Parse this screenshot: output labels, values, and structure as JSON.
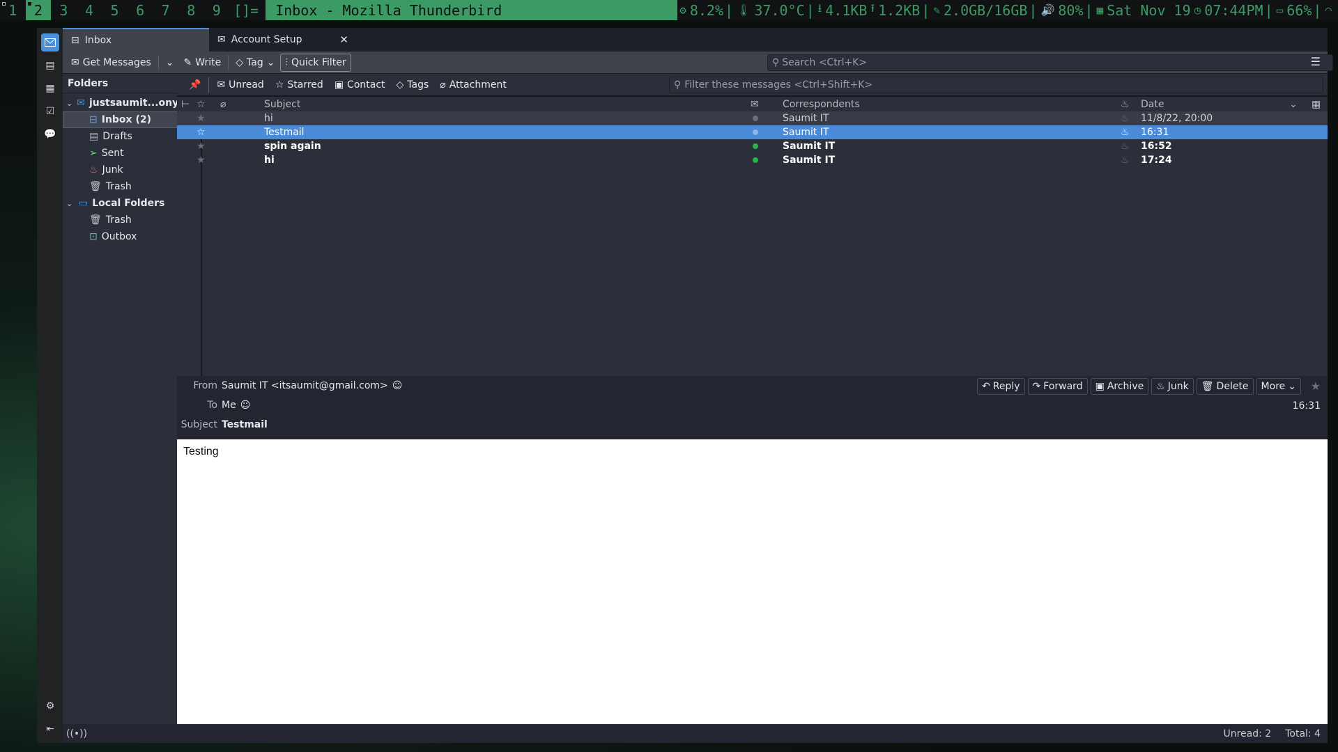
{
  "topbar": {
    "workspaces": [
      "1",
      "2",
      "3",
      "4",
      "5",
      "6",
      "7",
      "8",
      "9"
    ],
    "active_workspace": "2",
    "layout_symbol": "[]=",
    "window_title": "Inbox - Mozilla Thunderbird",
    "cpu": "8.2%",
    "temperature": "37.0°C",
    "download": "4.1KB",
    "upload": "1.2KB",
    "memory": "2.0GB/16GB",
    "volume": "80%",
    "date": "Sat Nov 19",
    "time": "07:44PM",
    "battery": "66%"
  },
  "tabs": [
    {
      "label": "Inbox",
      "active": true
    },
    {
      "label": "Account Setup",
      "active": false
    }
  ],
  "toolbar": {
    "get_messages": "Get Messages",
    "write": "Write",
    "tag": "Tag",
    "quick_filter": "Quick Filter",
    "search_placeholder": "Search <Ctrl+K>"
  },
  "folders": {
    "header": "Folders",
    "more": "···",
    "account": "justsaumit...onyan.xyz",
    "account_folders": [
      {
        "label": "Inbox (2)",
        "icon": "inbox-icon",
        "selected": true
      },
      {
        "label": "Drafts",
        "icon": "drafts-icon"
      },
      {
        "label": "Sent",
        "icon": "sent-icon"
      },
      {
        "label": "Junk",
        "icon": "junk-icon"
      },
      {
        "label": "Trash",
        "icon": "trash-icon"
      }
    ],
    "local": "Local Folders",
    "local_folders": [
      {
        "label": "Trash",
        "icon": "trash-icon"
      },
      {
        "label": "Outbox",
        "icon": "outbox-icon"
      }
    ]
  },
  "quickfilter": {
    "unread": "Unread",
    "starred": "Starred",
    "contact": "Contact",
    "tags": "Tags",
    "attachment": "Attachment",
    "filter_placeholder": "Filter these messages <Ctrl+Shift+K>"
  },
  "columns": {
    "subject": "Subject",
    "correspondents": "Correspondents",
    "date": "Date"
  },
  "messages": [
    {
      "subject": "hi",
      "correspondent": "Saumit IT",
      "date": "11/8/22, 20:00",
      "state": "read"
    },
    {
      "subject": "Testmail",
      "correspondent": "Saumit IT",
      "date": "16:31",
      "state": "selected"
    },
    {
      "subject": "spin again",
      "correspondent": "Saumit IT",
      "date": "16:52",
      "state": "unread"
    },
    {
      "subject": "hi",
      "correspondent": "Saumit IT",
      "date": "17:24",
      "state": "unread"
    }
  ],
  "message": {
    "from_label": "From",
    "from": "Saumit IT <itsaumit@gmail.com>",
    "to_label": "To",
    "to": "Me",
    "subject_label": "Subject",
    "subject": "Testmail",
    "time": "16:31",
    "body": "Testing",
    "buttons": {
      "reply": "Reply",
      "forward": "Forward",
      "archive": "Archive",
      "junk": "Junk",
      "delete": "Delete",
      "more": "More"
    }
  },
  "statusbar": {
    "unread": "Unread: 2",
    "total": "Total: 4"
  },
  "colors": {
    "accent": "#4a90d9",
    "bar_green": "#3c9a64",
    "unread_dot": "#2bb24c"
  }
}
